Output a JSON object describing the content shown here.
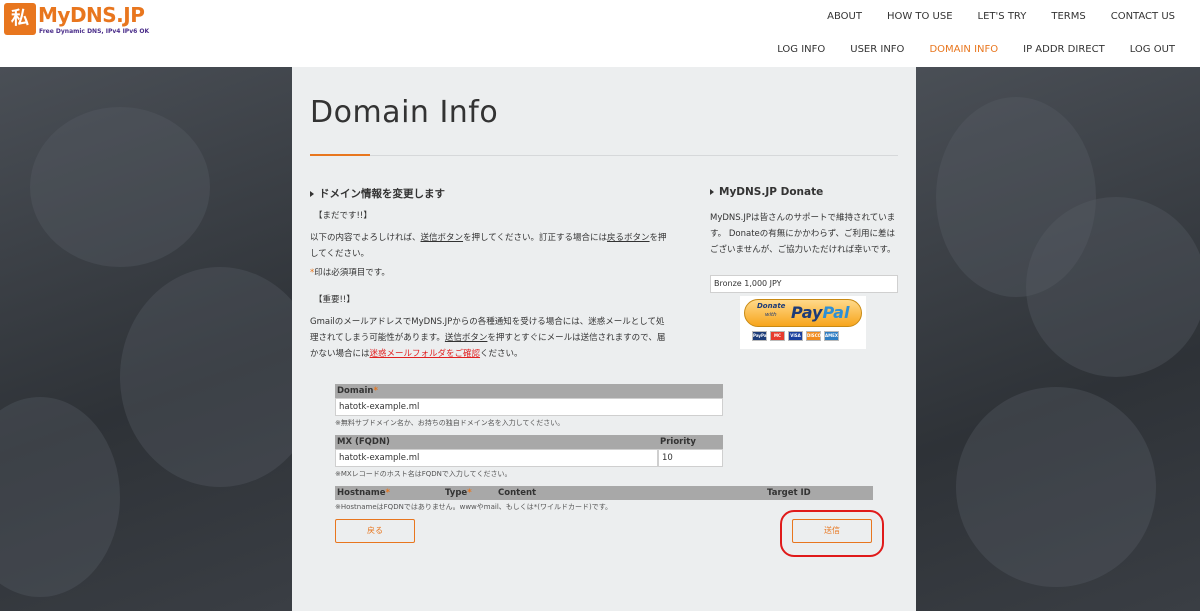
{
  "logo": {
    "mark": "私",
    "name": "MyDNS.JP",
    "tagline": "Free Dynamic DNS, IPv4 IPv6 OK"
  },
  "nav": {
    "top": [
      "ABOUT",
      "HOW TO USE",
      "LET'S TRY",
      "TERMS",
      "CONTACT US"
    ],
    "bottom": [
      "LOG INFO",
      "USER INFO",
      "DOMAIN INFO",
      "IP ADDR DIRECT",
      "LOG OUT"
    ],
    "active": "DOMAIN INFO"
  },
  "page": {
    "title": "Domain Info"
  },
  "main": {
    "heading": "ドメイン情報を変更します",
    "notyet": "【まだです!!】",
    "intro_p1": "以下の内容でよろしければ、",
    "intro_send": "送信ボタン",
    "intro_p2": "を押してください。訂正する場合には",
    "intro_back": "戻るボタン",
    "intro_p3": "を押",
    "intro_p4": "してください。",
    "required_mark": "*",
    "required_text": "印は必須項目です。",
    "important": "【重要!!】",
    "gmail_l1": "GmailのメールアドレスでMyDNS.JPからの各種通知を受ける場合には、迷惑メールとして処",
    "gmail_l2a": "理されてしまう可能性があります。",
    "gmail_send": "送信ボタン",
    "gmail_l2b": "を押すとすぐにメールは送信されますので、届",
    "gmail_l3a": "かない場合には",
    "gmail_link": "迷惑メールフォルダをご確認",
    "gmail_l3b": "ください。"
  },
  "donate": {
    "heading": "MyDNS.JP Donate",
    "text": "MyDNS.JPは皆さんのサポートで維持されています。 Donateの有無にかかわらず、ご利用に差はございませんが、ご協力いただければ幸いです。",
    "selected": "Bronze 1,000 JPY",
    "paypal_donate": "Donate",
    "paypal_with": "with",
    "paypal_pay": "Pay",
    "paypal_pal": "Pal",
    "cards": [
      "PayPal",
      "MC",
      "VISA",
      "DISCOVER",
      "AMEX"
    ]
  },
  "form": {
    "domain_label": "Domain",
    "req": "*",
    "domain_value": "hatotk-example.ml",
    "domain_note": "※無料サブドメイン名か、お持ちの独自ドメイン名を入力してください。",
    "mx_label": "MX (FQDN)",
    "priority_label": "Priority",
    "mx_value": "hatotk-example.ml",
    "priority_value": "10",
    "mx_note": "※MXレコードのホスト名はFQDNで入力してください。",
    "hostname_label": "Hostname",
    "type_label": "Type",
    "content_label": "Content",
    "target_label": "Target ID",
    "hostname_note": "※HostnameはFQDNではありません。wwwやmail、もしくは*(ワイルドカード)です。"
  },
  "buttons": {
    "back": "戻る",
    "send": "送信"
  },
  "colors": {
    "accent": "#e8761e",
    "highlight": "#e01a1a"
  }
}
